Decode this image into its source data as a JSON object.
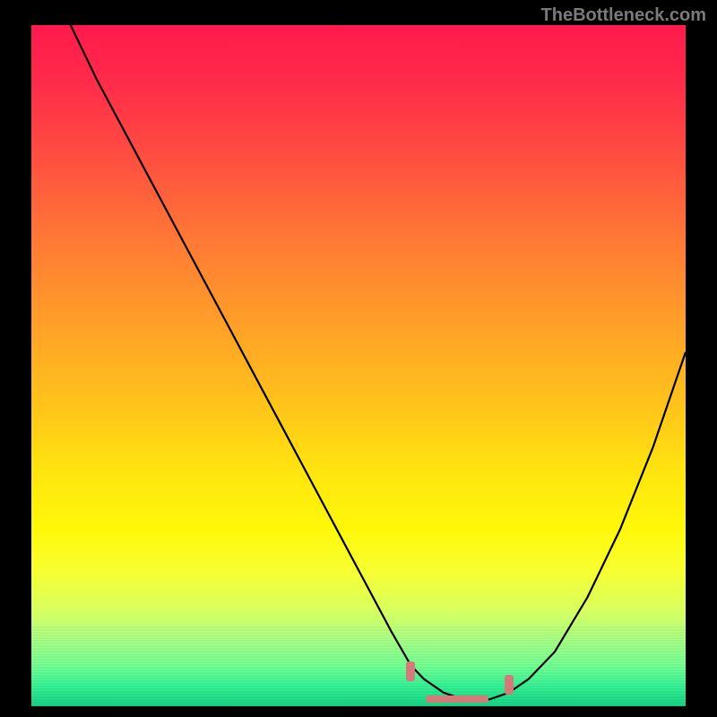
{
  "watermark": "TheBottleneck.com",
  "chart_data": {
    "type": "line",
    "title": "",
    "xlabel": "",
    "ylabel": "",
    "xlim": [
      0,
      100
    ],
    "ylim": [
      0,
      100
    ],
    "series": [
      {
        "name": "bottleneck-curve",
        "x": [
          6,
          10,
          15,
          20,
          25,
          30,
          35,
          40,
          45,
          50,
          55,
          58,
          60,
          63,
          66,
          70,
          73,
          76,
          80,
          85,
          90,
          95,
          100
        ],
        "y": [
          100,
          92,
          83,
          74,
          65,
          56,
          47,
          38,
          29,
          20,
          11,
          6,
          4,
          2,
          1,
          1,
          2,
          4,
          8,
          16,
          26,
          38,
          52
        ]
      }
    ],
    "markers": [
      {
        "name": "optimal-range-left",
        "x": 58,
        "y": 5
      },
      {
        "name": "optimal-range-bottom",
        "x": 65,
        "y": 1
      },
      {
        "name": "optimal-range-right",
        "x": 73,
        "y": 3
      }
    ],
    "gradient_stops": [
      {
        "pos": 0,
        "color": "#ff1a4d"
      },
      {
        "pos": 50,
        "color": "#ffc41a"
      },
      {
        "pos": 80,
        "color": "#f8ff30"
      },
      {
        "pos": 100,
        "color": "#10d080"
      }
    ]
  }
}
